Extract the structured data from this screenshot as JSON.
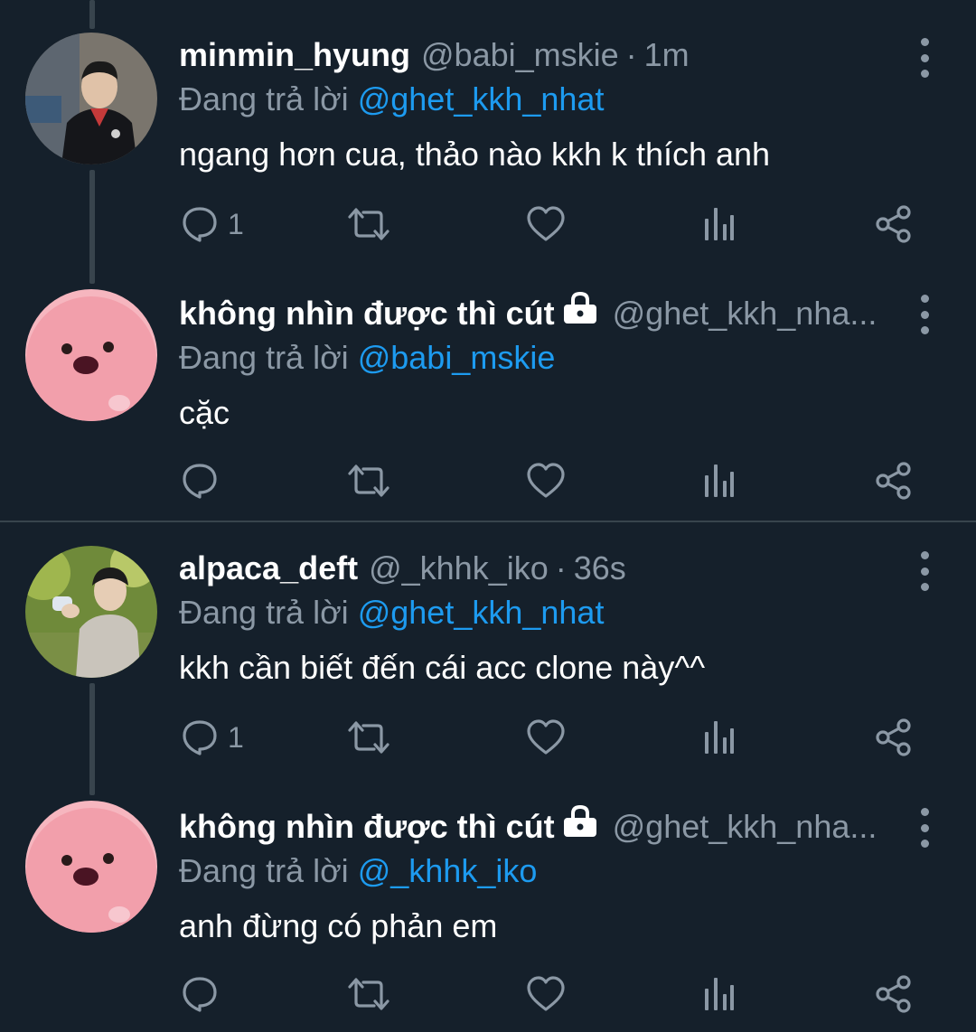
{
  "tweets": [
    {
      "name": "minmin_hyung",
      "handle": "@babi_mskie",
      "time": "1m",
      "locked": false,
      "reply_prefix": "Đang trả lời",
      "reply_to": "@ghet_kkh_nhat",
      "text": "ngang hơn cua, thảo nào kkh k thích anh",
      "reply_count": "1",
      "avatar": "photo-man-black-shirt"
    },
    {
      "name": "không nhìn được thì cút",
      "handle": "@ghet_kkh_nha...",
      "time": "",
      "locked": true,
      "reply_prefix": "Đang trả lời",
      "reply_to": "@babi_mskie",
      "text": "cặc",
      "reply_count": "",
      "avatar": "pink-loopy-cartoon"
    },
    {
      "name": "alpaca_deft",
      "handle": "@_khhk_iko",
      "time": "36s",
      "locked": false,
      "reply_prefix": "Đang trả lời",
      "reply_to": "@ghet_kkh_nhat",
      "text": "kkh cần biết đến cái acc clone này^^",
      "reply_count": "1",
      "avatar": "photo-man-outdoors"
    },
    {
      "name": "không nhìn được thì cút",
      "handle": "@ghet_kkh_nha...",
      "time": "",
      "locked": true,
      "reply_prefix": "Đang trả lời",
      "reply_to": "@_khhk_iko",
      "text": "anh đừng có phản em",
      "reply_count": "",
      "avatar": "pink-loopy-cartoon"
    }
  ],
  "separator": "·",
  "colors": {
    "background": "#15202b",
    "text": "#ffffff",
    "secondary": "#8b98a5",
    "accent": "#1d9bf0",
    "line": "#38444d"
  },
  "icons": {
    "reply": "reply-icon",
    "retweet": "retweet-icon",
    "like": "heart-icon",
    "views": "analytics-icon",
    "share": "share-icon",
    "more": "more-vertical-icon",
    "lock": "lock-icon"
  }
}
